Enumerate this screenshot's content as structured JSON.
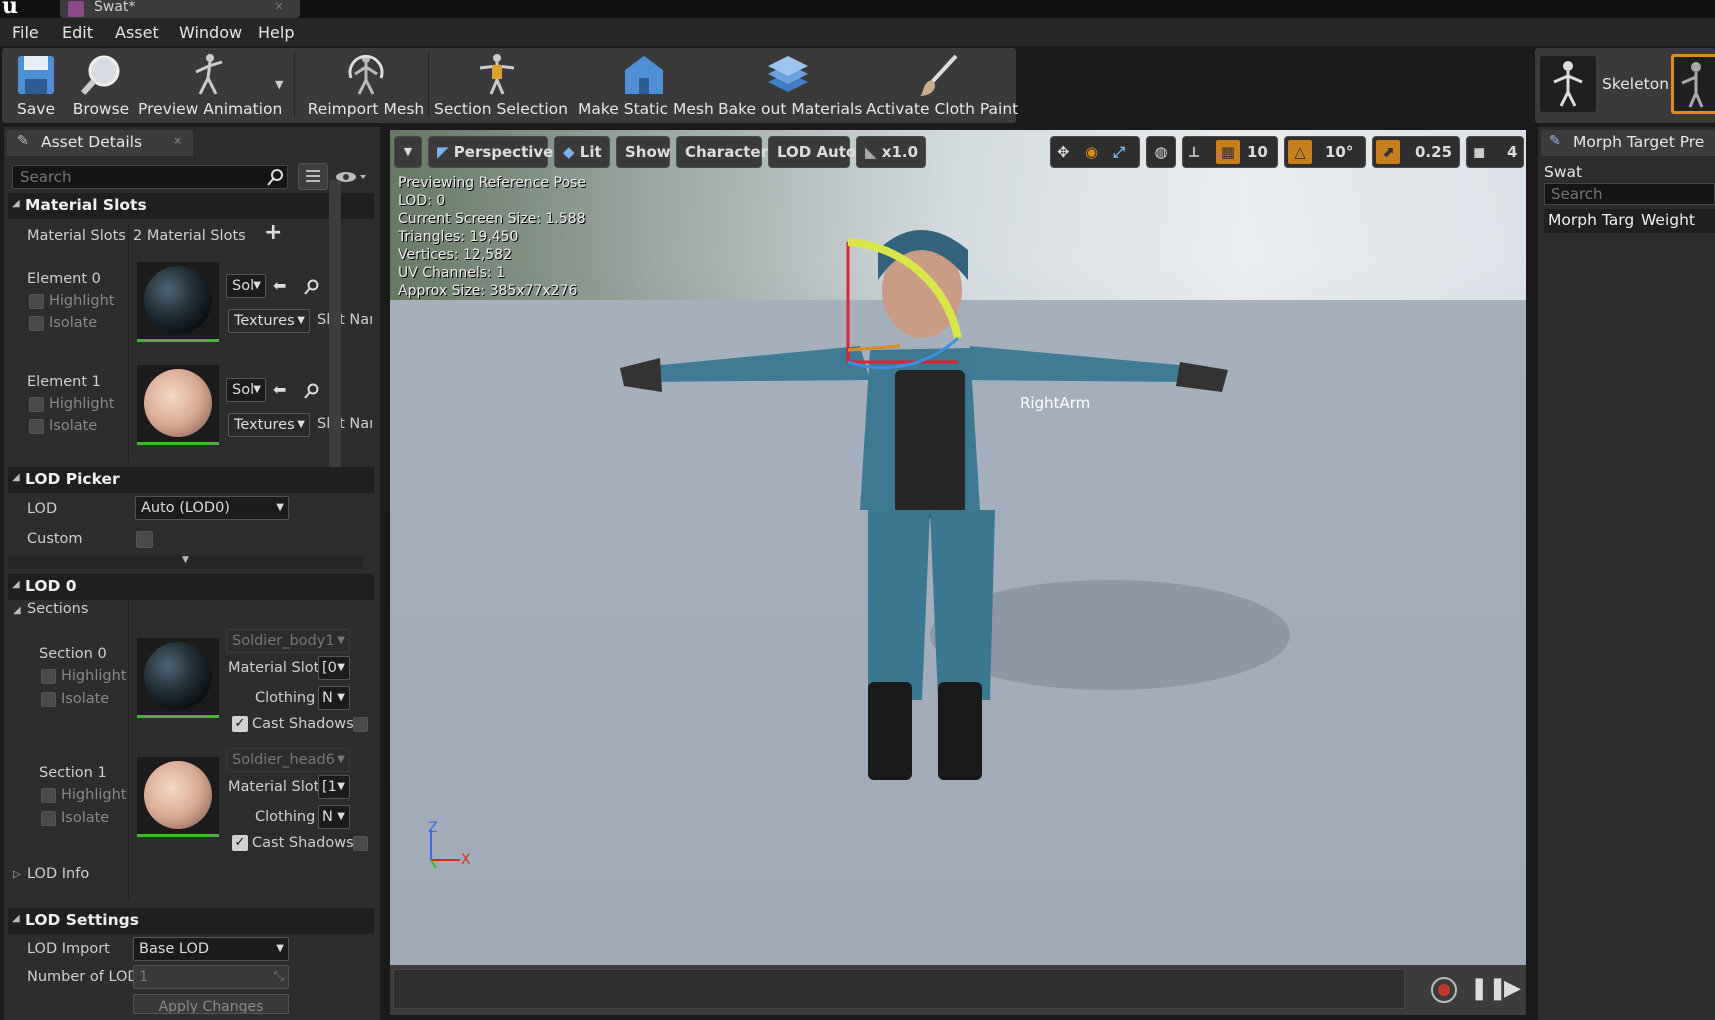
{
  "window": {
    "doc_tab": "Swat*",
    "close_glyph": "×"
  },
  "menu": [
    "File",
    "Edit",
    "Asset",
    "Window",
    "Help"
  ],
  "toolbar": {
    "buttons": [
      {
        "label": "Save",
        "icon": "save-icon"
      },
      {
        "label": "Browse",
        "icon": "browse-icon"
      },
      {
        "label": "Preview Animation",
        "icon": "preview-animation-icon"
      },
      {
        "label": "Reimport Mesh",
        "icon": "reimport-icon"
      },
      {
        "label": "Section Selection",
        "icon": "section-selection-icon"
      },
      {
        "label": "Make Static Mesh",
        "icon": "static-mesh-icon"
      },
      {
        "label": "Bake out Materials",
        "icon": "bake-materials-icon"
      },
      {
        "label": "Activate Cloth Paint",
        "icon": "cloth-paint-icon"
      }
    ],
    "skeleton_label": "Skeleton"
  },
  "asset_details": {
    "tab_label": "Asset Details",
    "tab_close": "×",
    "search_placeholder": "Search",
    "material_slots": {
      "header": "Material Slots",
      "row_label": "Material Slots",
      "row_value": "2 Material Slots",
      "add_glyph": "+",
      "elements": [
        {
          "label": "Element 0",
          "highlight": "Highlight",
          "isolate": "Isolate",
          "dd1": "Sol",
          "dd2": "Textures",
          "slot_name": "Slot Nam"
        },
        {
          "label": "Element 1",
          "highlight": "Highlight",
          "isolate": "Isolate",
          "dd1": "Sol",
          "dd2": "Textures",
          "slot_name": "Slot Nam"
        }
      ]
    },
    "lod_picker": {
      "header": "LOD Picker",
      "lod_label": "LOD",
      "lod_value": "Auto (LOD0)",
      "custom_label": "Custom"
    },
    "lod0": {
      "header": "LOD 0",
      "sections_label": "Sections",
      "sections": [
        {
          "label": "Section 0",
          "highlight": "Highlight",
          "isolate": "Isolate",
          "material": "Soldier_body1",
          "material_slot_label": "Material Slot",
          "material_slot_value": "[0",
          "clothing_label": "Clothing",
          "clothing_value": "N",
          "cast_shadows": "Cast Shadows"
        },
        {
          "label": "Section 1",
          "highlight": "Highlight",
          "isolate": "Isolate",
          "material": "Soldier_head6",
          "material_slot_label": "Material Slot",
          "material_slot_value": "[1",
          "clothing_label": "Clothing",
          "clothing_value": "N",
          "cast_shadows": "Cast Shadows"
        }
      ],
      "lod_info": "LOD Info"
    },
    "lod_settings": {
      "header": "LOD Settings",
      "lod_import_label": "LOD Import",
      "lod_import_value": "Base LOD",
      "number_label": "Number of LOD",
      "number_value": "1",
      "apply_button": "Apply Changes"
    }
  },
  "viewport": {
    "buttons": {
      "perspective": "Perspective",
      "lit": "Lit",
      "show": "Show",
      "character": "Character",
      "lod": "LOD Auto",
      "speed": "x1.0"
    },
    "right_tools": {
      "grid_snap": "10",
      "rotate_snap": "10°",
      "scale_snap": "0.25",
      "camera_speed": "4"
    },
    "info_lines": [
      "Previewing Reference Pose",
      "LOD: 0",
      "Current Screen Size: 1.588",
      "Triangles: 19,450",
      "Vertices: 12,582",
      "UV Channels: 1",
      "Approx Size: 385x77x276"
    ],
    "bone_label": "RightArm",
    "axis": {
      "z": "Z",
      "x": "X"
    }
  },
  "morph_panel": {
    "tab_label": "Morph Target Pre",
    "mesh_name": "Swat",
    "search_placeholder": "Search",
    "col1": "Morph Targ",
    "col2": "Weight"
  },
  "colors": {
    "accent_green": "#4bb03a",
    "snap_orange": "#c6801e",
    "record_red": "#c0392b",
    "panel_bg": "#2d2d2d"
  }
}
